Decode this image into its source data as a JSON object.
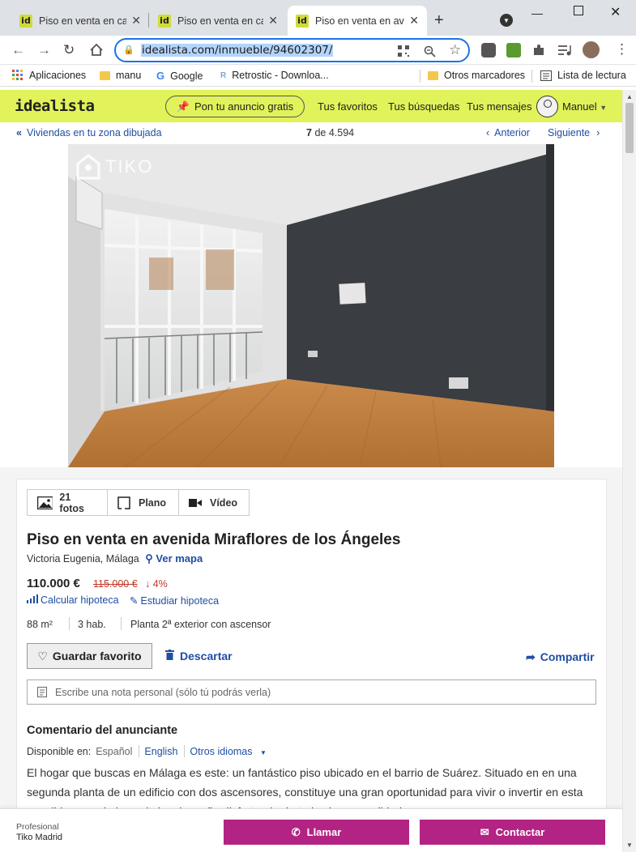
{
  "browser": {
    "tabs": [
      {
        "title": "Piso en venta en calle",
        "favicon": "id"
      },
      {
        "title": "Piso en venta en calle",
        "favicon": "id"
      },
      {
        "title": "Piso en venta en avenida",
        "favicon": "id"
      }
    ],
    "url": "idealista.com/inmueble/94602307/",
    "bookmarks": [
      {
        "label": "Aplicaciones",
        "icon": "apps-grid-icon"
      },
      {
        "label": "manu",
        "icon": "folder-icon"
      },
      {
        "label": "Google",
        "icon": "google-icon"
      },
      {
        "label": "Retrostic - Downloa...",
        "icon": "retrostic-icon"
      },
      {
        "label": "Otros marcadores",
        "icon": "folder-icon"
      },
      {
        "label": "Lista de lectura",
        "icon": "reading-list-icon"
      }
    ]
  },
  "site": {
    "logo": "idealista",
    "ad_button": "Pon tu anuncio gratis",
    "nav": [
      "Tus favoritos",
      "Tus búsquedas",
      "Tus mensajes"
    ],
    "user": "Manuel",
    "accent": "#e1f25a"
  },
  "listing_nav": {
    "back": "Viviendas en tu zona dibujada",
    "position": "7",
    "of": "de 4.594",
    "prev": "Anterior",
    "next": "Siguiente"
  },
  "photo": {
    "watermark": "TIKO"
  },
  "media_tabs": [
    {
      "label": "21 fotos",
      "icon": "image-icon"
    },
    {
      "label": "Plano",
      "icon": "floorplan-icon"
    },
    {
      "label": "Vídeo",
      "icon": "video-icon"
    }
  ],
  "listing": {
    "title": "Piso en venta en avenida Miraflores de los Ángeles",
    "location": "Victoria Eugenia, Málaga",
    "map_link": "Ver mapa",
    "price": "110.000 €",
    "old_price": "115.000 €",
    "drop": "4%",
    "mortgage_links": [
      "Calcular hipoteca",
      "Estudiar hipoteca"
    ],
    "features": [
      "88 m²",
      "3 hab.",
      "Planta 2ª exterior con ascensor"
    ],
    "favorite_button": "Guardar favorito",
    "discard": "Descartar",
    "share": "Compartir",
    "note_placeholder": "Escribe una nota personal (sólo tú podrás verla)",
    "comment_heading": "Comentario del anunciante",
    "available_in": "Disponible en:",
    "languages": [
      "Español",
      "English",
      "Otros idiomas"
    ],
    "description": "El hogar que buscas en Málaga es este: un fantástico piso ubicado en el barrio de Suárez. Situado en en una segunda planta de un edificio con dos ascensores, constituye una gran oportunidad para vivir o invertir en esta apacible zona de la capital malagueña disfrutando de todas las comodidades."
  },
  "contact_bar": {
    "type": "Profesional",
    "agency": "Tiko Madrid",
    "call": "Llamar",
    "contact": "Contactar",
    "button_color": "#b32383"
  }
}
